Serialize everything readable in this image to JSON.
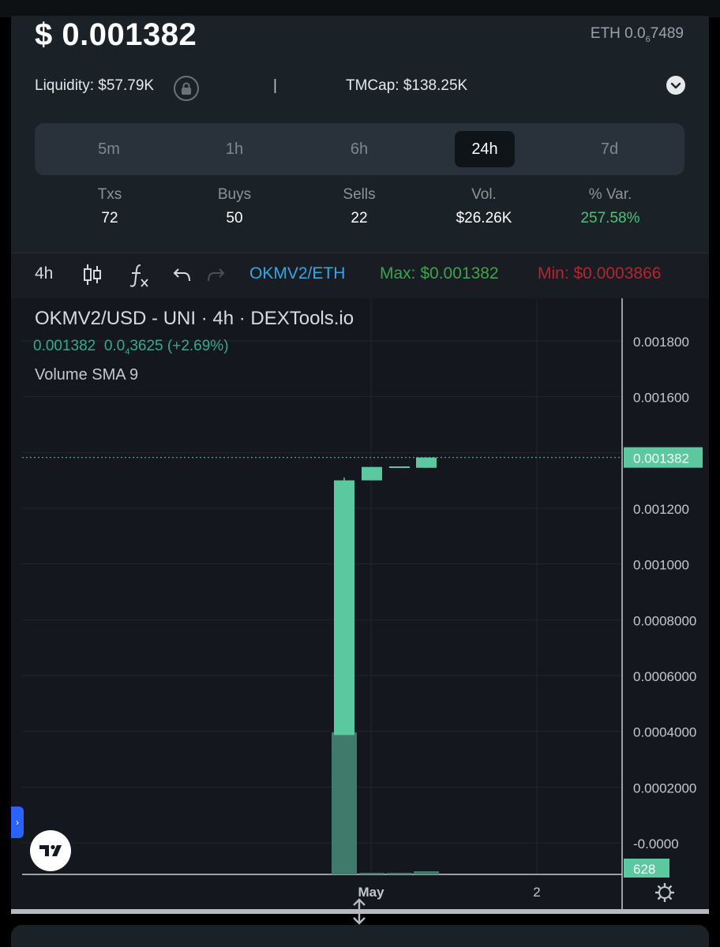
{
  "header": {
    "price": "$ 0.001382",
    "eth_price_prefix": "ETH 0.0",
    "eth_price_sub": "6",
    "eth_price_suffix": "7489",
    "liquidity": "Liquidity: $57.79K",
    "separator": "|",
    "tmcap": "TMCap: $138.25K"
  },
  "timeframes": [
    {
      "label": "5m",
      "active": false
    },
    {
      "label": "1h",
      "active": false
    },
    {
      "label": "6h",
      "active": false
    },
    {
      "label": "24h",
      "active": true
    },
    {
      "label": "7d",
      "active": false
    }
  ],
  "stats": [
    {
      "label": "Txs",
      "value": "72"
    },
    {
      "label": "Buys",
      "value": "50"
    },
    {
      "label": "Sells",
      "value": "22"
    },
    {
      "label": "Vol.",
      "value": "$26.26K"
    },
    {
      "label": "% Var.",
      "value": "257.58%"
    }
  ],
  "toolbar": {
    "interval": "4h",
    "pair": "OKMV2/ETH",
    "max": "Max: $0.001382",
    "min": "Min: $0.0003866"
  },
  "legend": {
    "title": "OKMV2/USD - UNI · 4h · DEXTools.io",
    "value_last": "0.001382",
    "value_change_prefix": "0.0",
    "value_change_sub": "4",
    "value_change_suffix": "3625 (+2.69%)",
    "volume": "Volume SMA 9"
  },
  "colors": {
    "up": "#5bc8a0",
    "volume": "#3f7a6a",
    "pair": "#2ea8e8",
    "max": "#39a54a",
    "min": "#b3262f",
    "positive": "#4cc27a"
  },
  "chart_data": {
    "type": "candlestick",
    "title": "OKMV2/USD - UNI · 4h · DEXTools.io",
    "x_ticks": [
      "May",
      "2"
    ],
    "y_ticks": [
      "0.001800",
      "0.001600",
      "0.001200",
      "0.001000",
      "0.0008000",
      "0.0006000",
      "0.0004000",
      "0.0002000",
      "-0.0000"
    ],
    "y_ticks_values": [
      0.0018,
      0.0016,
      0.0012,
      0.001,
      0.0008,
      0.0006,
      0.0004,
      0.0002,
      0
    ],
    "ylim": [
      -5e-05,
      0.00195
    ],
    "current_price_label": "0.001382",
    "current_price": 0.001382,
    "volume_label": "628",
    "candles": [
      {
        "open": 0.0003866,
        "close": 0.0013,
        "high": 0.00131,
        "low": 0.0003866
      },
      {
        "open": 0.0013,
        "close": 0.001348,
        "high": 0.001348,
        "low": 0.0013
      },
      {
        "open": 0.001345,
        "close": 0.00135,
        "high": 0.00135,
        "low": 0.001345
      },
      {
        "open": 0.001345,
        "close": 0.001382,
        "high": 0.001382,
        "low": 0.001345
      }
    ],
    "volume": [
      628,
      4,
      3,
      14
    ]
  }
}
